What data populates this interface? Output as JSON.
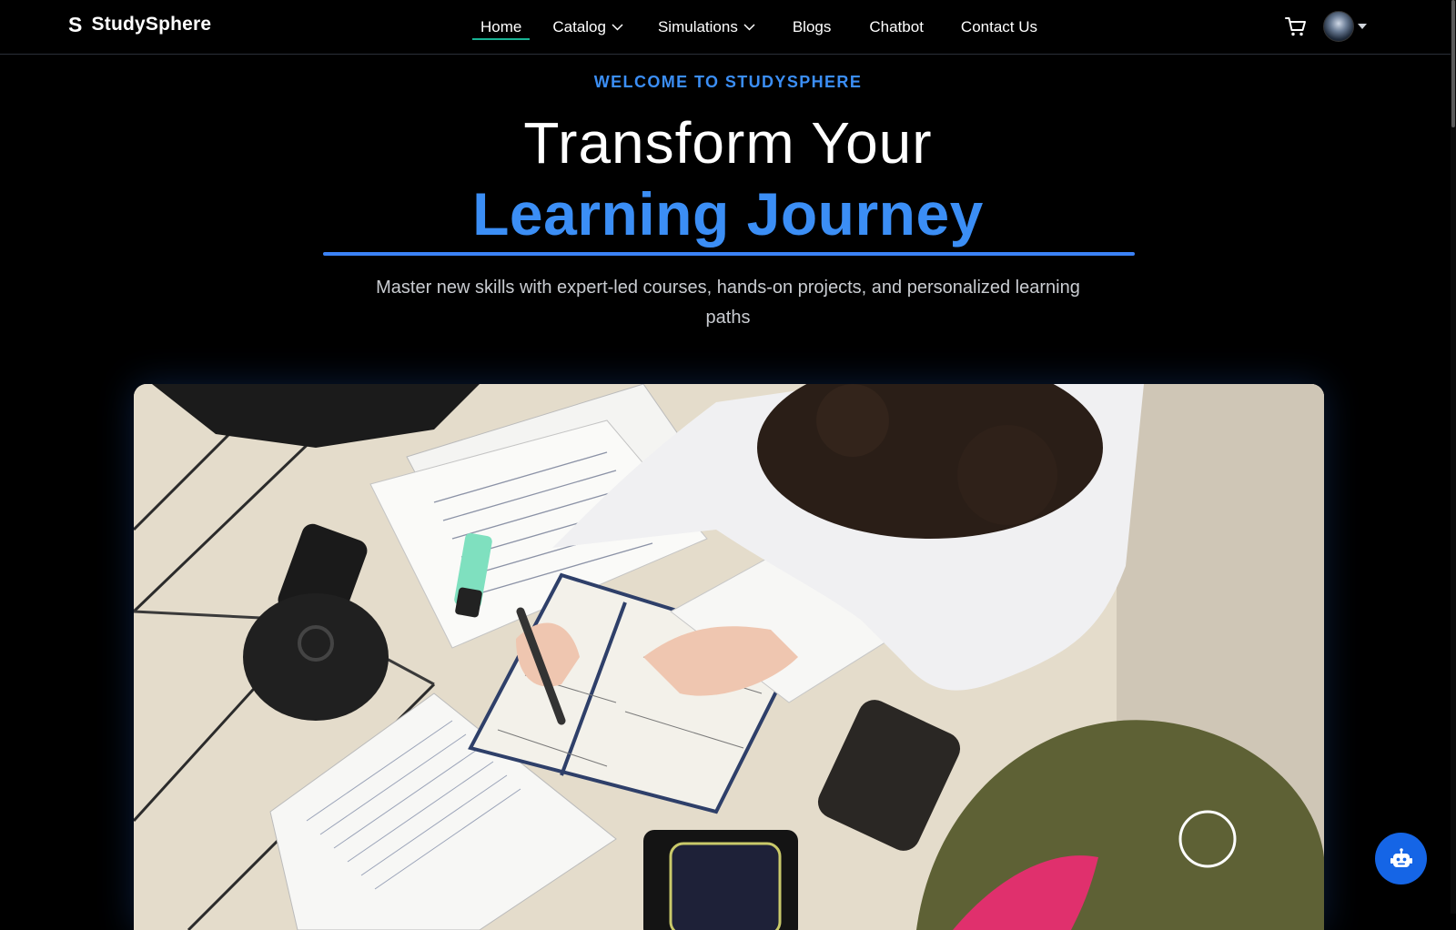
{
  "brand": {
    "logo": "S",
    "name": "StudySphere"
  },
  "nav": {
    "items": [
      {
        "label": "Home",
        "active": true,
        "dropdown": false
      },
      {
        "label": "Catalog",
        "active": false,
        "dropdown": true
      },
      {
        "label": "Simulations",
        "active": false,
        "dropdown": true
      },
      {
        "label": "Blogs",
        "active": false,
        "dropdown": false
      },
      {
        "label": "Chatbot",
        "active": false,
        "dropdown": false
      },
      {
        "label": "Contact Us",
        "active": false,
        "dropdown": false
      }
    ],
    "icons": {
      "cart": "cart-icon",
      "avatar": "user-avatar",
      "caret": "caret-down-icon"
    }
  },
  "hero": {
    "eyebrow": "WELCOME TO STUDYSPHERE",
    "headline_line1": "Transform Your",
    "headline_line2": "Learning Journey",
    "subtitle": "Master new skills with expert-led courses, hands-on projects, and personalized learning paths"
  },
  "chat_fab": {
    "icon": "robot-icon"
  },
  "colors": {
    "background": "#000000",
    "accent_blue": "#3b8ef5",
    "active_underline": "#19b394",
    "fab": "#1565e6",
    "subtitle_text": "#c9ccd1"
  }
}
